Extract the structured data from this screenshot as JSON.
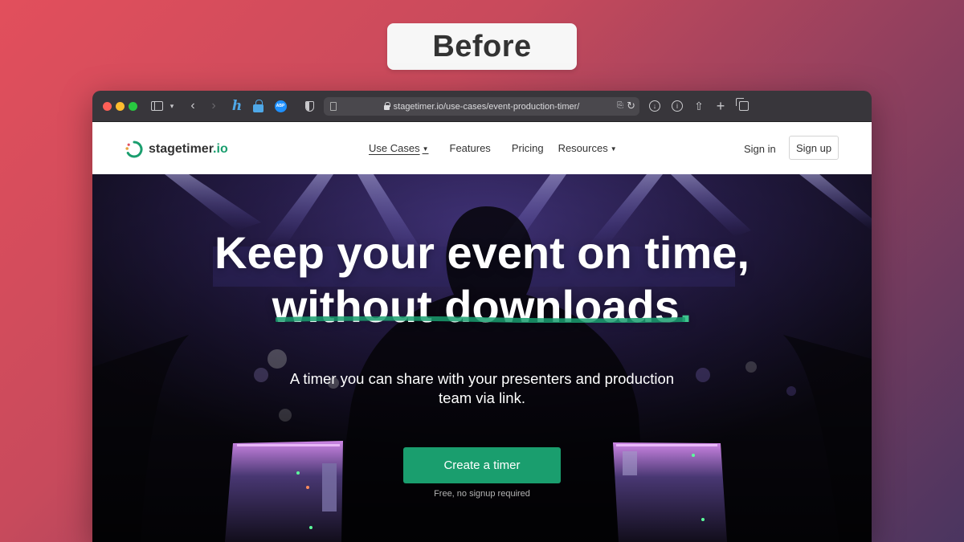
{
  "overlay": {
    "label": "Before"
  },
  "browser": {
    "url": "stagetimer.io/use-cases/event-production-timer/",
    "translate_icon": "translate-icon",
    "reload_icon": "reload-icon"
  },
  "site": {
    "logo_text": "stagetimer",
    "logo_tld": ".io",
    "nav": [
      {
        "label": "Use Cases",
        "has_caret": true,
        "active": true
      },
      {
        "label": "Features",
        "has_caret": false
      },
      {
        "label": "Pricing",
        "has_caret": false
      },
      {
        "label": "Resources",
        "has_caret": true
      }
    ],
    "signin_label": "Sign in",
    "signup_label": "Sign up"
  },
  "hero": {
    "headline_line1": "Keep your event on time,",
    "headline_line2": "without downloads",
    "headline_dot": ".",
    "subheadline": "A timer you can share with your presenters and production team via link.",
    "cta_label": "Create a timer",
    "cta_note": "Free, no signup required"
  },
  "colors": {
    "brand_green": "#1a9e6e",
    "accent_green": "#3fc48e"
  }
}
